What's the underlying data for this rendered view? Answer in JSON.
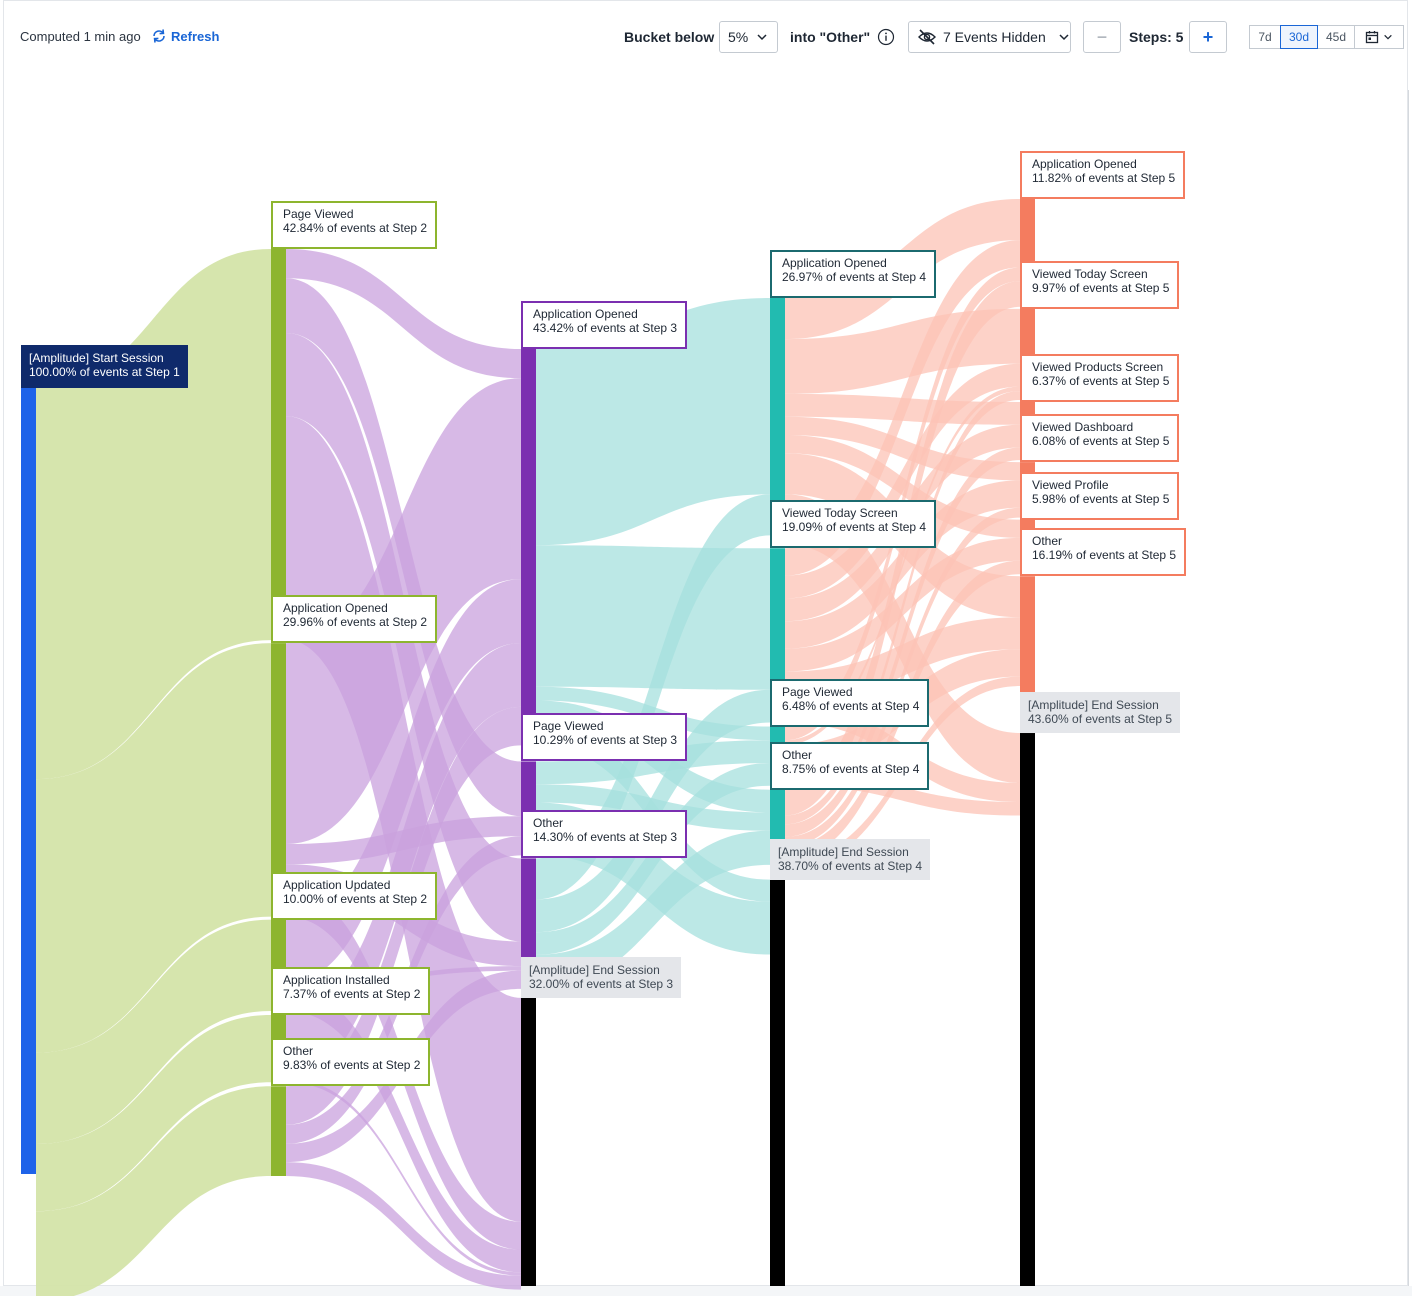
{
  "toolbar": {
    "computed_text": "Computed 1 min ago",
    "refresh_label": "Refresh",
    "bucket_label": "Bucket below",
    "bucket_value": "5%",
    "into_other_label": "into \"Other\"",
    "hidden_events_label": "7 Events Hidden",
    "minus_label": "−",
    "steps_label": "Steps: 5",
    "plus_label": "+",
    "ranges": [
      "7d",
      "30d",
      "45d"
    ],
    "active_range": "30d"
  },
  "colors": {
    "step1": "#1e63e9",
    "step1_label": "#0f2a6b",
    "step2": "#8db52e",
    "step2_flow": "#d4e4a9",
    "step3": "#7b2fb0",
    "step3_flow": "#c9a2de",
    "step4": "#22bbb0",
    "step4_border": "#1b6a6f",
    "step4_flow": "#a6e0dd",
    "step5": "#f47c5f",
    "step5_flow": "#fcc3b5",
    "end": "#000000",
    "end_label_bg": "#e4e6ea"
  },
  "icons": {
    "refresh": "refresh-icon",
    "info": "info-icon",
    "hidden": "eye-slash-icon",
    "calendar": "calendar-icon",
    "chevron": "chevron-down-icon"
  },
  "chart_data": {
    "type": "sankey",
    "steps": [
      {
        "step": 1,
        "nodes": [
          {
            "name": "[Amplitude] Start Session",
            "percent": 100.0,
            "label": "100.00% of events at Step 1"
          }
        ]
      },
      {
        "step": 2,
        "nodes": [
          {
            "name": "Page Viewed",
            "percent": 42.84,
            "label": "42.84% of events at Step 2"
          },
          {
            "name": "Application Opened",
            "percent": 29.96,
            "label": "29.96% of events at Step 2"
          },
          {
            "name": "Application Updated",
            "percent": 10.0,
            "label": "10.00% of events at Step 2"
          },
          {
            "name": "Application Installed",
            "percent": 7.37,
            "label": "7.37% of events at Step 2"
          },
          {
            "name": "Other",
            "percent": 9.83,
            "label": "9.83% of events at Step 2"
          }
        ]
      },
      {
        "step": 3,
        "nodes": [
          {
            "name": "Application Opened",
            "percent": 43.42,
            "label": "43.42% of events at Step 3"
          },
          {
            "name": "Page Viewed",
            "percent": 10.29,
            "label": "10.29% of events at Step 3"
          },
          {
            "name": "Other",
            "percent": 14.3,
            "label": "14.30% of events at Step 3"
          },
          {
            "name": "[Amplitude] End Session",
            "percent": 32.0,
            "label": "32.00% of events at Step 3"
          }
        ]
      },
      {
        "step": 4,
        "nodes": [
          {
            "name": "Application Opened",
            "percent": 26.97,
            "label": "26.97% of events at Step 4"
          },
          {
            "name": "Viewed Today Screen",
            "percent": 19.09,
            "label": "19.09% of events at Step 4"
          },
          {
            "name": "Page Viewed",
            "percent": 6.48,
            "label": "6.48% of events at Step 4"
          },
          {
            "name": "Other",
            "percent": 8.75,
            "label": "8.75% of events at Step 4"
          },
          {
            "name": "[Amplitude] End Session",
            "percent": 38.7,
            "label": "38.70% of events at Step 4"
          }
        ]
      },
      {
        "step": 5,
        "nodes": [
          {
            "name": "Application Opened",
            "percent": 11.82,
            "label": "11.82% of events at Step 5"
          },
          {
            "name": "Viewed Today Screen",
            "percent": 9.97,
            "label": "9.97% of events at Step 5"
          },
          {
            "name": "Viewed Products Screen",
            "percent": 6.37,
            "label": "6.37% of events at Step 5"
          },
          {
            "name": "Viewed Dashboard",
            "percent": 6.08,
            "label": "6.08% of events at Step 5"
          },
          {
            "name": "Viewed Profile",
            "percent": 5.98,
            "label": "5.98% of events at Step 5"
          },
          {
            "name": "Other",
            "percent": 16.19,
            "label": "16.19% of events at Step 5"
          },
          {
            "name": "[Amplitude] End Session",
            "percent": 43.6,
            "label": "43.60% of events at Step 5"
          }
        ]
      }
    ],
    "links": [
      {
        "from_step": 1,
        "from": "[Amplitude] Start Session",
        "to": "Page Viewed",
        "percent": 42.84
      },
      {
        "from_step": 1,
        "from": "[Amplitude] Start Session",
        "to": "Application Opened",
        "percent": 29.96
      },
      {
        "from_step": 1,
        "from": "[Amplitude] Start Session",
        "to": "Application Updated",
        "percent": 10.0
      },
      {
        "from_step": 1,
        "from": "[Amplitude] Start Session",
        "to": "Application Installed",
        "percent": 7.37
      },
      {
        "from_step": 1,
        "from": "[Amplitude] Start Session",
        "to": "Other",
        "percent": 9.83
      },
      {
        "from_step": 2,
        "from": "Page Viewed",
        "to": "Application Opened",
        "percent": 3.2
      },
      {
        "from_step": 2,
        "from": "Page Viewed",
        "to": "Page Viewed",
        "percent": 6.0
      },
      {
        "from_step": 2,
        "from": "Page Viewed",
        "to": "Other",
        "percent": 9.1
      },
      {
        "from_step": 2,
        "from": "Page Viewed",
        "to": "[Amplitude] End Session",
        "percent": 24.5
      },
      {
        "from_step": 2,
        "from": "Application Opened",
        "to": "Application Opened",
        "percent": 22.0
      },
      {
        "from_step": 2,
        "from": "Application Opened",
        "to": "Page Viewed",
        "percent": 2.2
      },
      {
        "from_step": 2,
        "from": "Application Opened",
        "to": "Other",
        "percent": 2.7
      },
      {
        "from_step": 2,
        "from": "Application Opened",
        "to": "[Amplitude] End Session",
        "percent": 3.06
      },
      {
        "from_step": 2,
        "from": "Application Updated",
        "to": "Application Opened",
        "percent": 7.0
      },
      {
        "from_step": 2,
        "from": "Application Updated",
        "to": "Other",
        "percent": 0.5
      },
      {
        "from_step": 2,
        "from": "Application Updated",
        "to": "[Amplitude] End Session",
        "percent": 2.5
      },
      {
        "from_step": 2,
        "from": "Application Installed",
        "to": "Application Opened",
        "percent": 7.0
      },
      {
        "from_step": 2,
        "from": "Application Installed",
        "to": "[Amplitude] End Session",
        "percent": 0.37
      },
      {
        "from_step": 2,
        "from": "Other",
        "to": "Application Opened",
        "percent": 4.22
      },
      {
        "from_step": 2,
        "from": "Other",
        "to": "Page Viewed",
        "percent": 2.09
      },
      {
        "from_step": 2,
        "from": "Other",
        "to": "Other",
        "percent": 2.0
      },
      {
        "from_step": 2,
        "from": "Other",
        "to": "[Amplitude] End Session",
        "percent": 1.52
      },
      {
        "from_step": 3,
        "from": "Application Opened",
        "to": "Application Opened",
        "percent": 21.5
      },
      {
        "from_step": 3,
        "from": "Application Opened",
        "to": "Viewed Today Screen",
        "percent": 15.5
      },
      {
        "from_step": 3,
        "from": "Application Opened",
        "to": "Page Viewed",
        "percent": 1.5
      },
      {
        "from_step": 3,
        "from": "Application Opened",
        "to": "Other",
        "percent": 2.5
      },
      {
        "from_step": 3,
        "from": "Application Opened",
        "to": "[Amplitude] End Session",
        "percent": 2.42
      },
      {
        "from_step": 3,
        "from": "Page Viewed",
        "to": "Page Viewed",
        "percent": 2.5
      },
      {
        "from_step": 3,
        "from": "Page Viewed",
        "to": "Other",
        "percent": 2.0
      },
      {
        "from_step": 3,
        "from": "Page Viewed",
        "to": "[Amplitude] End Session",
        "percent": 5.79
      },
      {
        "from_step": 3,
        "from": "Other",
        "to": "Application Opened",
        "percent": 4.5
      },
      {
        "from_step": 3,
        "from": "Other",
        "to": "Viewed Today Screen",
        "percent": 3.59
      },
      {
        "from_step": 3,
        "from": "Other",
        "to": "Page Viewed",
        "percent": 2.48
      },
      {
        "from_step": 3,
        "from": "Other",
        "to": "Other",
        "percent": 3.73
      },
      {
        "from_step": 4,
        "from": "Application Opened",
        "to": "Application Opened",
        "percent": 4.5
      },
      {
        "from_step": 4,
        "from": "Application Opened",
        "to": "Viewed Today Screen",
        "percent": 6.0
      },
      {
        "from_step": 4,
        "from": "Application Opened",
        "to": "Viewed Products Screen",
        "percent": 2.5
      },
      {
        "from_step": 4,
        "from": "Application Opened",
        "to": "Viewed Dashboard",
        "percent": 2.0
      },
      {
        "from_step": 4,
        "from": "Application Opened",
        "to": "Viewed Profile",
        "percent": 2.0
      },
      {
        "from_step": 4,
        "from": "Application Opened",
        "to": "Other",
        "percent": 4.5
      },
      {
        "from_step": 4,
        "from": "Application Opened",
        "to": "[Amplitude] End Session",
        "percent": 5.47
      },
      {
        "from_step": 4,
        "from": "Viewed Today Screen",
        "to": "Application Opened",
        "percent": 3.0
      },
      {
        "from_step": 4,
        "from": "Viewed Today Screen",
        "to": "Viewed Today Screen",
        "percent": 2.5
      },
      {
        "from_step": 4,
        "from": "Viewed Today Screen",
        "to": "Viewed Products Screen",
        "percent": 2.5
      },
      {
        "from_step": 4,
        "from": "Viewed Today Screen",
        "to": "Viewed Dashboard",
        "percent": 3.0
      },
      {
        "from_step": 4,
        "from": "Viewed Today Screen",
        "to": "Viewed Profile",
        "percent": 2.5
      },
      {
        "from_step": 4,
        "from": "Viewed Today Screen",
        "to": "Other",
        "percent": 3.5
      },
      {
        "from_step": 4,
        "from": "Viewed Today Screen",
        "to": "[Amplitude] End Session",
        "percent": 2.09
      },
      {
        "from_step": 4,
        "from": "Page Viewed",
        "to": "Application Opened",
        "percent": 1.5
      },
      {
        "from_step": 4,
        "from": "Page Viewed",
        "to": "Viewed Today Screen",
        "percent": 0.5
      },
      {
        "from_step": 4,
        "from": "Page Viewed",
        "to": "Other",
        "percent": 3.0
      },
      {
        "from_step": 4,
        "from": "Page Viewed",
        "to": "[Amplitude] End Session",
        "percent": 1.48
      },
      {
        "from_step": 4,
        "from": "Other",
        "to": "Application Opened",
        "percent": 2.82
      },
      {
        "from_step": 4,
        "from": "Other",
        "to": "Viewed Today Screen",
        "percent": 0.97
      },
      {
        "from_step": 4,
        "from": "Other",
        "to": "Viewed Products Screen",
        "percent": 1.37
      },
      {
        "from_step": 4,
        "from": "Other",
        "to": "Viewed Dashboard",
        "percent": 1.08
      },
      {
        "from_step": 4,
        "from": "Other",
        "to": "Viewed Profile",
        "percent": 1.48
      },
      {
        "from_step": 4,
        "from": "Other",
        "to": "Other",
        "percent": 1.03
      }
    ]
  }
}
